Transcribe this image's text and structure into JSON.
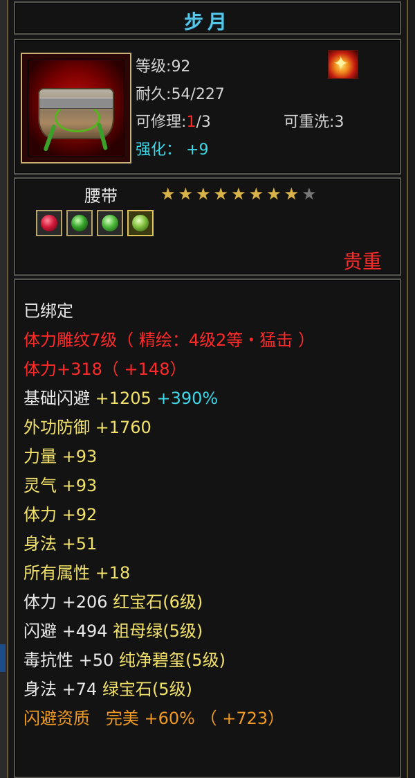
{
  "title": "步月",
  "item": {
    "level_label": "等级",
    "level_value": "92",
    "durability_label": "耐久",
    "durability_value": "54/227",
    "repair_label": "可修理",
    "repair_current": "1",
    "repair_max": "/3",
    "reroll_label": "可重洗",
    "reroll_value": "3",
    "enhance_label": "强化：",
    "enhance_value": "+9",
    "type": "腰带",
    "stars_filled": 8,
    "stars_total": 9,
    "rarity": "贵重",
    "icon": "belt-icon",
    "badge_icon": "fire-badge-icon"
  },
  "gems": [
    {
      "name": "ruby-gem",
      "color": "#d21a3a"
    },
    {
      "name": "emerald-gem",
      "color": "#35a32a"
    },
    {
      "name": "green-gem",
      "color": "#4cb83a"
    },
    {
      "name": "jade-gem",
      "color": "#7fbf3a"
    }
  ],
  "stats": {
    "bound": "已绑定",
    "engrave": "体力雕纹7级（ 精绘：4级2等・猛击 ）",
    "stamina_main": "体力+318",
    "stamina_bonus": "（ +148）",
    "base_dodge_label": "基础闪避",
    "base_dodge_value": "+1205",
    "base_dodge_pct": "+390%",
    "ext_def_label": "外功防御",
    "ext_def_value": "+1760",
    "rows": [
      {
        "label": "力量",
        "value": "+93"
      },
      {
        "label": "灵气",
        "value": "+93"
      },
      {
        "label": "体力",
        "value": "+92"
      },
      {
        "label": "身法",
        "value": "+51"
      },
      {
        "label": "所有属性",
        "value": "+18"
      }
    ],
    "gem_rows": [
      {
        "label": "体力",
        "value": "+206",
        "gem": "红宝石",
        "lvl": "(6级)"
      },
      {
        "label": "闪避",
        "value": "+494",
        "gem": "祖母绿",
        "lvl": "(5级)"
      },
      {
        "label": "毒抗性",
        "value": "+50",
        "gem": "纯净碧玺",
        "lvl": "(5级)"
      },
      {
        "label": "身法",
        "value": "+74",
        "gem": "绿宝石",
        "lvl": "(5级)"
      }
    ],
    "aptitude_label": "闪避资质",
    "aptitude_grade": "完美",
    "aptitude_pct": "+60%",
    "aptitude_bonus": "（ +723）"
  }
}
